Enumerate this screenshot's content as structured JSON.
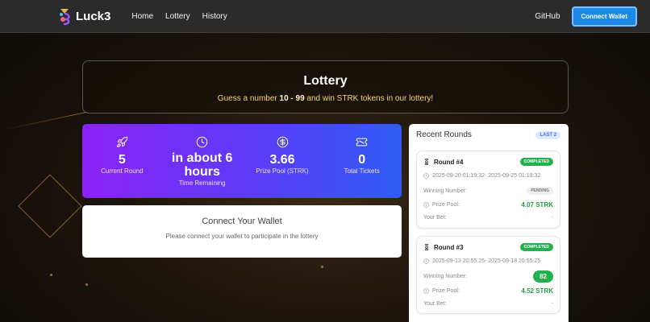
{
  "header": {
    "brand": "Luck3",
    "nav": [
      {
        "label": "Home"
      },
      {
        "label": "Lottery"
      },
      {
        "label": "History"
      }
    ],
    "github_label": "GitHub",
    "connect_label": "Connect Wallet"
  },
  "hero": {
    "title": "Lottery",
    "subtitle_before": "Guess a number ",
    "subtitle_range": "10 - 99",
    "subtitle_after": " and win STRK tokens in our lottery!"
  },
  "stats": [
    {
      "icon": "rocket-icon",
      "value": "5",
      "label": "Current Round"
    },
    {
      "icon": "clock-icon",
      "value": "in about 6 hours",
      "label": "Time Remaining"
    },
    {
      "icon": "dollar-icon",
      "value": "3.66",
      "label": "Prize Pool (STRK)"
    },
    {
      "icon": "ticket-icon",
      "value": "0",
      "label": "Total Tickets"
    }
  ],
  "connect_card": {
    "title": "Connect Your Wallet",
    "description": "Please connect your wallet to participate in the lottery"
  },
  "recent_rounds": {
    "title": "Recent Rounds",
    "badge": "LAST 2",
    "rounds": [
      {
        "name": "Round #4",
        "status": "COMPLETED",
        "dates": "2025-09-20 01:19:32- 2025-09-25 01:19:32",
        "winning_label": "Winning Number:",
        "winning_value": "PENDING",
        "prize_label": "Prize Pool:",
        "prize_value": "4.07 STRK",
        "bet_label": "Your Bet:",
        "bet_value": "-"
      },
      {
        "name": "Round #3",
        "status": "COMPLETED",
        "dates": "2025-09-13 20:55:25- 2025-09-18 20:55:25",
        "winning_label": "Winning Number:",
        "winning_value": "82",
        "prize_label": "Prize Pool:",
        "prize_value": "4.52 STRK",
        "bet_label": "Your Bet:",
        "bet_value": "-"
      }
    ]
  },
  "colors": {
    "accent": "#1e88e5",
    "gradient_start": "#8b22f5",
    "gradient_end": "#2f5cf6",
    "success": "#22b14c",
    "highlight": "#f6d776"
  }
}
